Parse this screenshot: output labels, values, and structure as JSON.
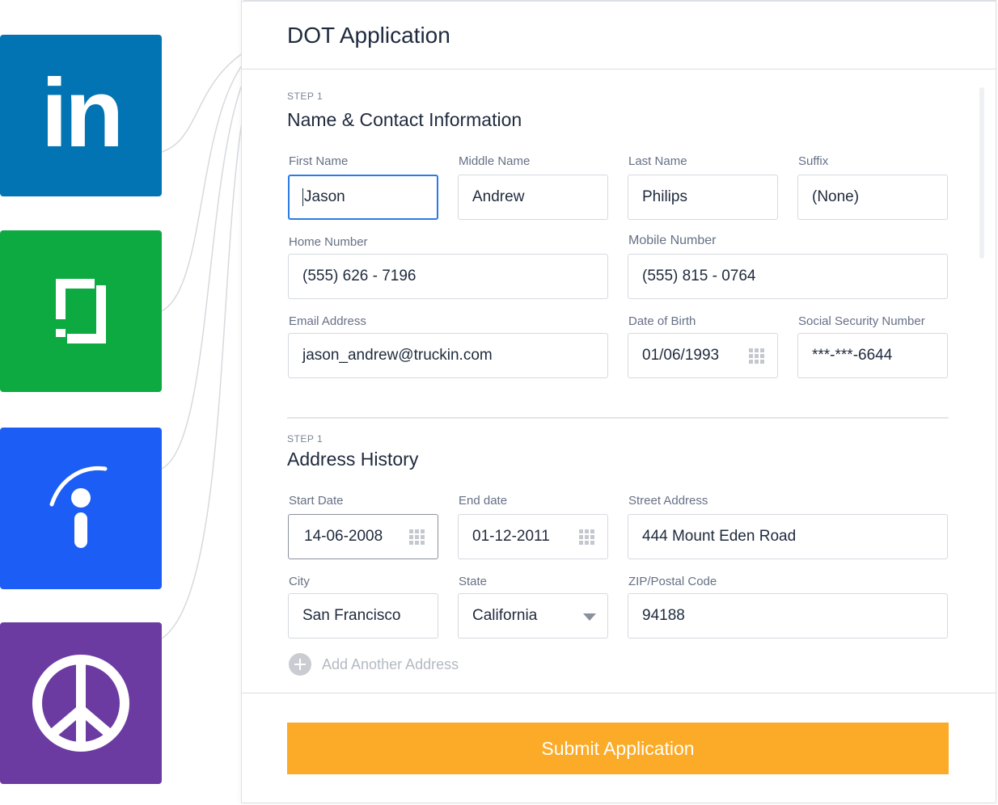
{
  "sources": [
    {
      "name": "linkedin",
      "glyph": "in",
      "color": "#0274b3"
    },
    {
      "name": "glassdoor",
      "color": "#0caa41"
    },
    {
      "name": "indeed",
      "color": "#1c5ef5"
    },
    {
      "name": "peace",
      "color": "#6c3ba2"
    }
  ],
  "form": {
    "title": "DOT Application",
    "sections": [
      {
        "step": "STEP 1",
        "title": "Name & Contact Information",
        "fields": {
          "first_name": {
            "label": "First Name",
            "value": "Jason"
          },
          "middle_name": {
            "label": "Middle Name",
            "value": "Andrew"
          },
          "last_name": {
            "label": "Last Name",
            "value": "Philips"
          },
          "suffix": {
            "label": "Suffix",
            "value": "(None)"
          },
          "home_number": {
            "label": "Home Number",
            "value": "(555) 626 - 7196"
          },
          "mobile_number": {
            "label": "Mobile Number",
            "value": "(555) 815 - 0764"
          },
          "email": {
            "label": "Email Address",
            "value": "jason_andrew@truckin.com"
          },
          "dob": {
            "label": "Date of Birth",
            "value": "01/06/1993"
          },
          "ssn": {
            "label": "Social Security Number",
            "value": "***-***-6644"
          }
        }
      },
      {
        "step": "STEP 1",
        "title": "Address History",
        "fields": {
          "start_date": {
            "label": "Start Date",
            "value": "14-06-2008"
          },
          "end_date": {
            "label": "End date",
            "value": "01-12-2011"
          },
          "street": {
            "label": "Street Address",
            "value": "444 Mount Eden Road"
          },
          "city": {
            "label": "City",
            "value": "San Francisco"
          },
          "state": {
            "label": "State",
            "value": "California"
          },
          "zip": {
            "label": "ZIP/Postal Code",
            "value": "94188"
          }
        },
        "add_another": "Add Another Address"
      }
    ],
    "submit_label": "Submit Application",
    "colors": {
      "accent": "#fbab27",
      "focus": "#2c7be5"
    }
  }
}
